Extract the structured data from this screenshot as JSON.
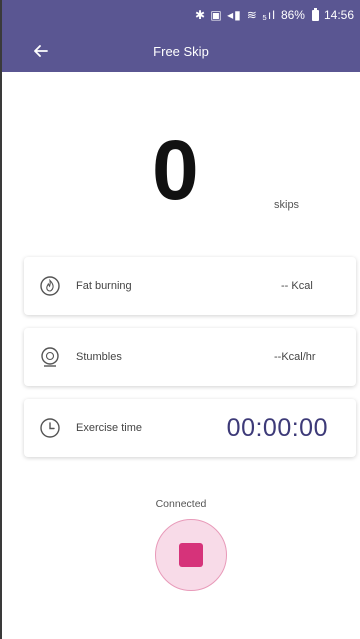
{
  "status_bar": {
    "icons_text": "✱ ▣ ◂▮",
    "signal_text": "≋ ₅ıl",
    "battery": "86%",
    "time": "14:56"
  },
  "app_bar": {
    "title": "Free Skip",
    "back_icon": "arrow-left-icon"
  },
  "counter": {
    "value": "0",
    "unit": "skips"
  },
  "metrics": [
    {
      "icon": "flame-icon",
      "label": "Fat burning",
      "value": "-- Kcal"
    },
    {
      "icon": "stumble-icon",
      "label": "Stumbles",
      "value": "--Kcal/hr"
    },
    {
      "icon": "clock-icon",
      "label": "Exercise time",
      "value": "00:00:00"
    }
  ],
  "connection": {
    "status": "Connected"
  },
  "colors": {
    "header": "#5a5692",
    "time_value": "#3d3a78",
    "stop_button": "#d6337a",
    "stop_ring": "#f8dbe8"
  }
}
